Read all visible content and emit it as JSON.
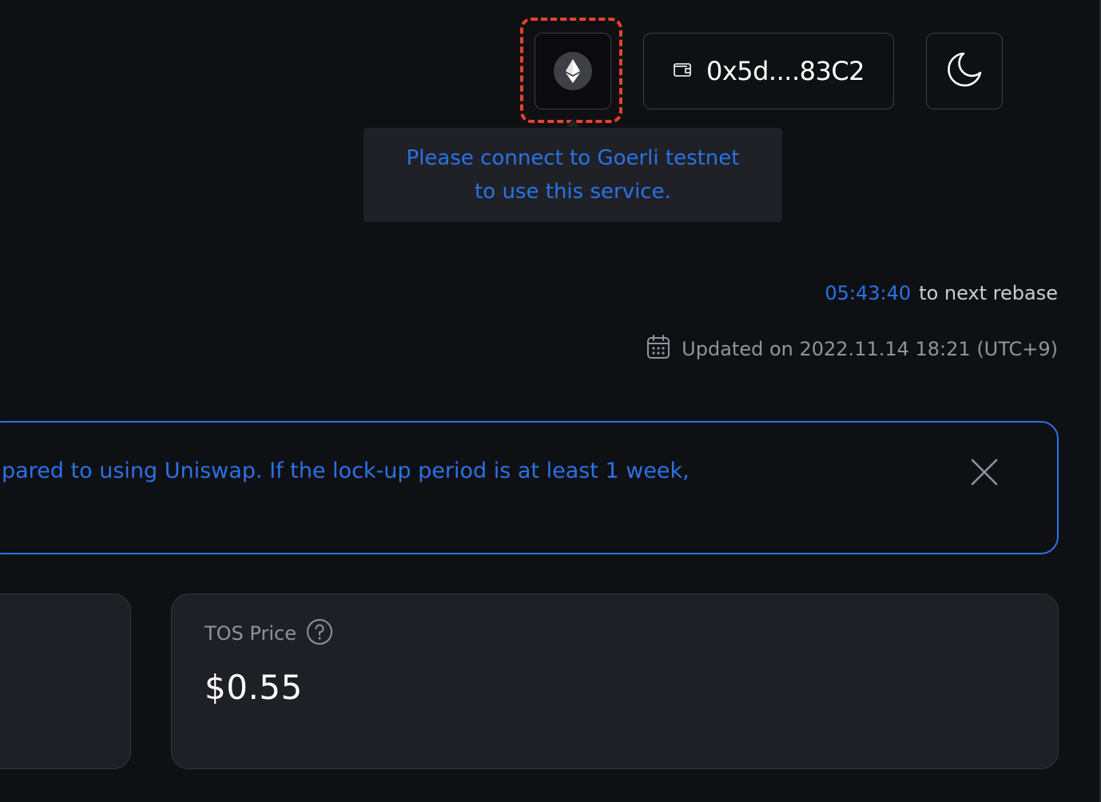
{
  "header": {
    "network_icon": "ethereum-icon",
    "wallet_icon": "wallet-icon",
    "wallet_address": "0x5d....83C2",
    "theme_icon": "moon-icon"
  },
  "tooltip": {
    "line1": "Please connect to Goerli testnet",
    "line2": "to use this service."
  },
  "rebase": {
    "countdown": "05:43:40",
    "label": "to next rebase"
  },
  "updated": {
    "icon": "calendar-icon",
    "text": "Updated on 2022.11.14 18:21 (UTC+9)"
  },
  "notice": {
    "text": "pared to using Uniswap. If the lock-up period is at least 1 week,",
    "close_icon": "close-icon"
  },
  "cards": {
    "tos_price": {
      "title": "TOS Price",
      "help_icon": "question-circle-icon",
      "value": "$0.55"
    }
  },
  "colors": {
    "accent_blue": "#2a72e5",
    "highlight_red": "#e5432d",
    "background": "#0f1014",
    "card_bg": "#1f2025"
  }
}
